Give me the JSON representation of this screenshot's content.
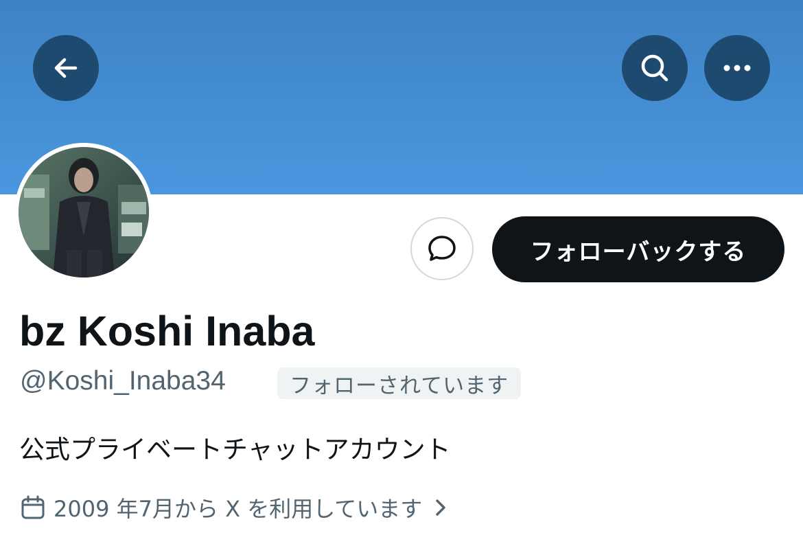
{
  "profile": {
    "display_name": "bz Koshi Inaba",
    "handle": "@Koshi_Inaba34",
    "follows_you_badge": "フォローされています",
    "bio": "公式プライベートチャットアカウント",
    "joined": "2009 年7月から X を利用しています"
  },
  "actions": {
    "follow_back_label": "フォローバックする"
  },
  "icons": {
    "back": "arrow-left-icon",
    "search": "search-icon",
    "more": "more-dots-icon",
    "message": "message-bubble-icon",
    "calendar": "calendar-icon",
    "chevron": "chevron-right-icon"
  },
  "colors": {
    "banner_top": "#3d82c4",
    "banner_bottom": "#4b97df",
    "nav_button_bg": "#1f4a6f",
    "primary_button_bg": "#0f1419",
    "secondary_text": "#536471",
    "badge_bg": "#eff3f4"
  }
}
